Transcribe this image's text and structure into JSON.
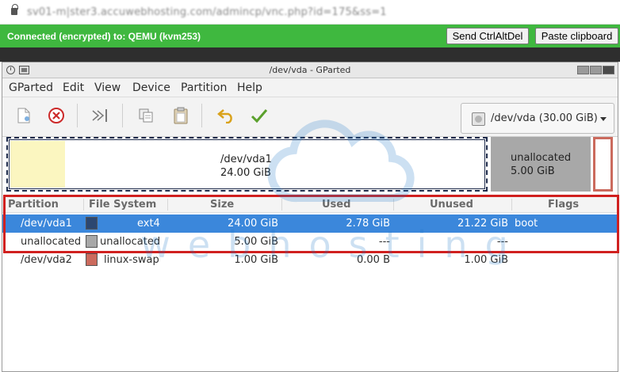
{
  "browser": {
    "url": "sv01-m|ster3.accuwebhosting.com/admincp/vnc.php?id=175&ss=1"
  },
  "vnc": {
    "status": "Connected (encrypted) to: QEMU (kvm253)",
    "send_ctrl_alt_del": "Send CtrlAltDel",
    "paste_clipboard": "Paste clipboard"
  },
  "window": {
    "title": "/dev/vda - GParted"
  },
  "menu": [
    "GParted",
    "Edit",
    "View",
    "Device",
    "Partition",
    "Help"
  ],
  "toolbar": {
    "icons": [
      "new-icon",
      "delete-icon",
      "resize-move-icon",
      "copy-icon",
      "paste-icon",
      "undo-icon",
      "apply-icon"
    ],
    "device": "/dev/vda (30.00 GiB)"
  },
  "partition_map": {
    "vda1": {
      "name": "/dev/vda1",
      "size": "24.00 GiB",
      "used_fraction": 0.116
    },
    "unallocated": {
      "name": "unallocated",
      "size": "5.00 GiB"
    },
    "vda2": {
      "name": "/dev/vda2"
    }
  },
  "table": {
    "headers": [
      "Partition",
      "File System",
      "Size",
      "Used",
      "Unused",
      "Flags"
    ],
    "rows": [
      {
        "partition": "/dev/vda1",
        "filesystem": "ext4",
        "size": "24.00 GiB",
        "used": "2.78 GiB",
        "unused": "21.22 GiB",
        "flags": "boot",
        "color": "#2c4770"
      },
      {
        "partition": "unallocated",
        "filesystem": "unallocated",
        "size": "5.00 GiB",
        "used": "---",
        "unused": "---",
        "flags": "",
        "color": "#a8a8a8"
      },
      {
        "partition": "/dev/vda2",
        "filesystem": "linux-swap",
        "size": "1.00 GiB",
        "used": "0.00 B",
        "unused": "1.00 GiB",
        "flags": "",
        "color": "#cb6a5d"
      }
    ]
  },
  "watermark": {
    "text": "webhosting"
  },
  "colors": {
    "vnc_green": "#3fb83f",
    "selection_blue": "#3b87db",
    "highlight_red": "#d0201f",
    "used_yellow": "#fbf6c0"
  }
}
